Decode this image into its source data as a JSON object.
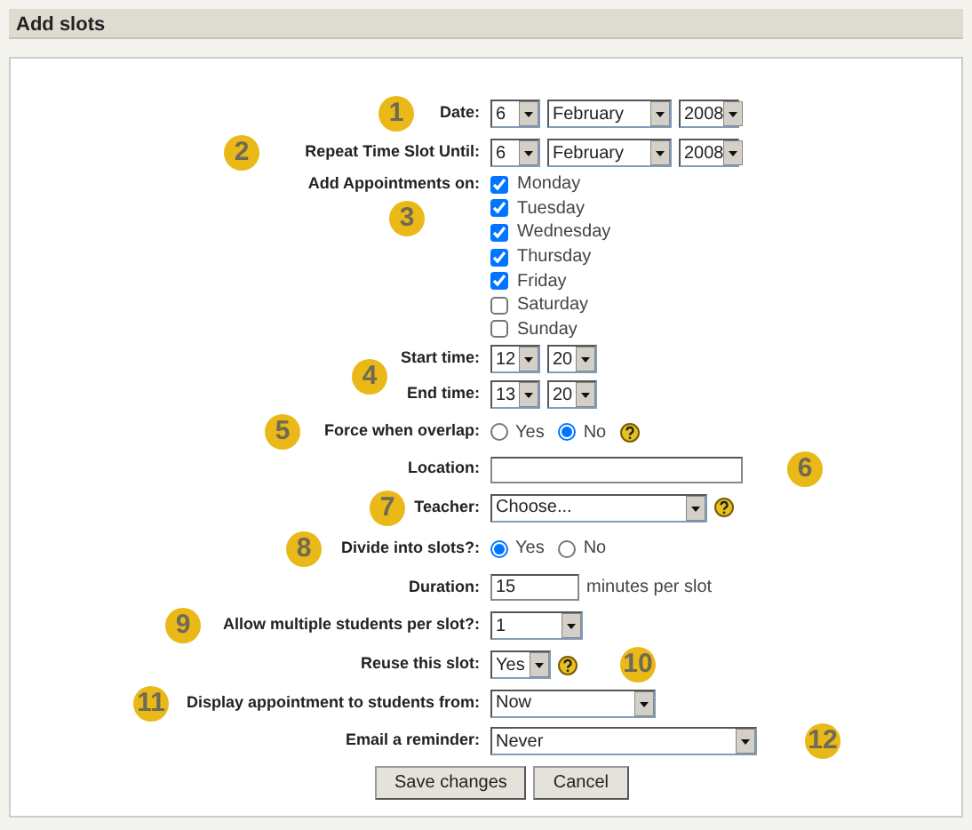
{
  "header": {
    "title": "Add slots"
  },
  "fields": [
    {
      "kind": "selects",
      "label": "Date:",
      "callout": "1",
      "selects": [
        {
          "value": "6"
        },
        {
          "value": "February"
        },
        {
          "value": "2008"
        }
      ]
    },
    {
      "kind": "selects",
      "label": "Repeat Time Slot Until:",
      "callout": "2",
      "selects": [
        {
          "value": "6"
        },
        {
          "value": "February"
        },
        {
          "value": "2008"
        }
      ]
    },
    {
      "kind": "checkboxes",
      "label": "Add Appointments on:",
      "callout": "3",
      "options": [
        {
          "label": "Monday",
          "checked": true
        },
        {
          "label": "Tuesday",
          "checked": true
        },
        {
          "label": "Wednesday",
          "checked": true
        },
        {
          "label": "Thursday",
          "checked": true
        },
        {
          "label": "Friday",
          "checked": true
        },
        {
          "label": "Saturday",
          "checked": false
        },
        {
          "label": "Sunday",
          "checked": false
        }
      ]
    },
    {
      "kind": "selects",
      "label": "Start time:",
      "callout": "4",
      "selects": [
        {
          "value": "12"
        },
        {
          "value": "20"
        }
      ]
    },
    {
      "kind": "selects",
      "label": "End time:",
      "selects": [
        {
          "value": "13"
        },
        {
          "value": "20"
        }
      ]
    },
    {
      "kind": "radios",
      "label": "Force when overlap:",
      "callout": "5",
      "help": true,
      "options": [
        {
          "label": "Yes",
          "selected": false
        },
        {
          "label": "No",
          "selected": true
        }
      ]
    },
    {
      "kind": "text",
      "label": "Location:",
      "callout": "6"
    },
    {
      "kind": "selects",
      "label": "Teacher:",
      "callout": "7",
      "help": true,
      "selects": [
        {
          "value": "Choose..."
        }
      ]
    },
    {
      "kind": "radios",
      "label": "Divide into slots?:",
      "callout": "8",
      "options": [
        {
          "label": "Yes",
          "selected": true
        },
        {
          "label": "No",
          "selected": false
        }
      ]
    },
    {
      "kind": "text",
      "label": "Duration:",
      "value": "15",
      "suffix": "minutes per slot"
    },
    {
      "kind": "selects",
      "label": "Allow multiple students per slot?:",
      "callout": "9",
      "selects": [
        {
          "value": "1"
        }
      ]
    },
    {
      "kind": "selects",
      "label": "Reuse this slot:",
      "callout": "10",
      "help": true,
      "selects": [
        {
          "value": "Yes"
        }
      ]
    },
    {
      "kind": "selects",
      "label": "Display appointment to students from:",
      "callout": "11",
      "selects": [
        {
          "value": "Now"
        }
      ]
    },
    {
      "kind": "selects",
      "label": "Email a reminder:",
      "callout": "12",
      "selects": [
        {
          "value": "Never"
        }
      ]
    }
  ],
  "buttons": [
    {
      "label": "Save changes"
    },
    {
      "label": "Cancel"
    }
  ]
}
